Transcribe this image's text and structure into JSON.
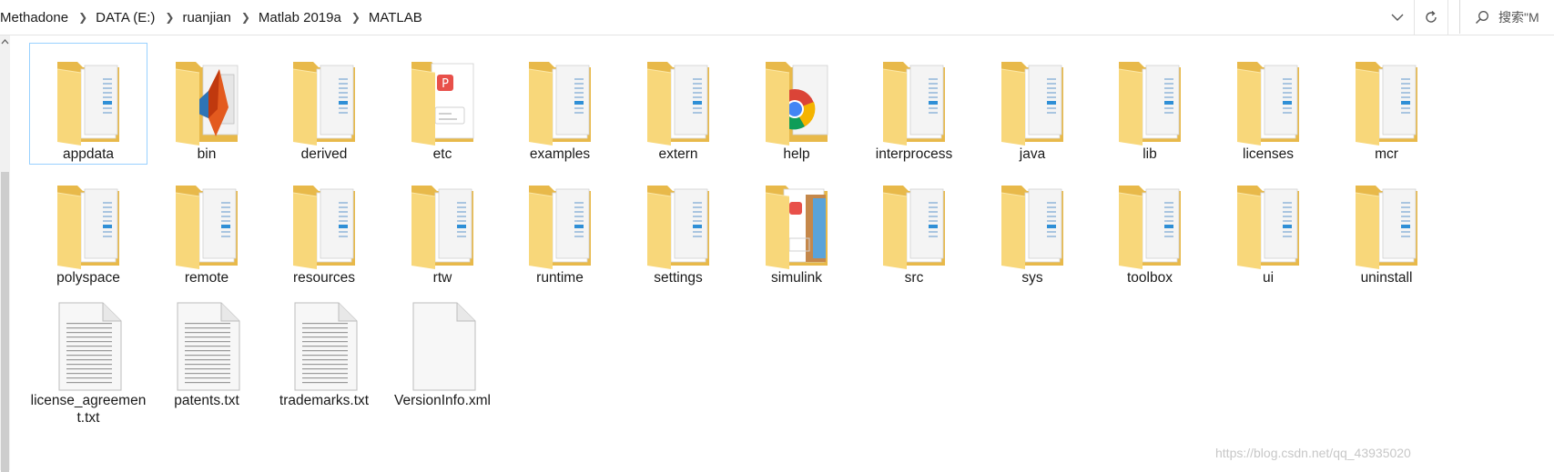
{
  "address_bar": {
    "breadcrumbs": [
      "Methadone",
      "DATA (E:)",
      "ruanjian",
      "Matlab 2019a",
      "MATLAB"
    ],
    "search_placeholder": "搜索\"M"
  },
  "items": [
    {
      "label": "appdata",
      "type": "folder",
      "icon": "folder-icon",
      "selected": true
    },
    {
      "label": "bin",
      "type": "folder",
      "icon": "matlab-folder-icon"
    },
    {
      "label": "derived",
      "type": "folder",
      "icon": "folder-icon"
    },
    {
      "label": "etc",
      "type": "folder",
      "icon": "pdf-folder-icon"
    },
    {
      "label": "examples",
      "type": "folder",
      "icon": "folder-icon"
    },
    {
      "label": "extern",
      "type": "folder",
      "icon": "folder-icon"
    },
    {
      "label": "help",
      "type": "folder",
      "icon": "chrome-folder-icon"
    },
    {
      "label": "interprocess",
      "type": "folder",
      "icon": "folder-icon"
    },
    {
      "label": "java",
      "type": "folder",
      "icon": "folder-icon"
    },
    {
      "label": "lib",
      "type": "folder",
      "icon": "folder-icon"
    },
    {
      "label": "licenses",
      "type": "folder",
      "icon": "folder-icon"
    },
    {
      "label": "mcr",
      "type": "folder",
      "icon": "folder-icon"
    },
    {
      "label": "polyspace",
      "type": "folder",
      "icon": "folder-icon"
    },
    {
      "label": "remote",
      "type": "folder",
      "icon": "folder-icon"
    },
    {
      "label": "resources",
      "type": "folder",
      "icon": "folder-icon"
    },
    {
      "label": "rtw",
      "type": "folder",
      "icon": "folder-icon"
    },
    {
      "label": "runtime",
      "type": "folder",
      "icon": "folder-icon"
    },
    {
      "label": "settings",
      "type": "folder",
      "icon": "folder-icon"
    },
    {
      "label": "simulink",
      "type": "folder",
      "icon": "image-folder-icon"
    },
    {
      "label": "src",
      "type": "folder",
      "icon": "folder-icon"
    },
    {
      "label": "sys",
      "type": "folder",
      "icon": "folder-icon"
    },
    {
      "label": "toolbox",
      "type": "folder",
      "icon": "folder-icon"
    },
    {
      "label": "ui",
      "type": "folder",
      "icon": "folder-icon"
    },
    {
      "label": "uninstall",
      "type": "folder",
      "icon": "folder-icon"
    },
    {
      "label": "license_agreement.txt",
      "type": "text",
      "icon": "text-file-icon"
    },
    {
      "label": "patents.txt",
      "type": "text",
      "icon": "text-file-icon"
    },
    {
      "label": "trademarks.txt",
      "type": "text",
      "icon": "text-file-icon"
    },
    {
      "label": "VersionInfo.xml",
      "type": "xml",
      "icon": "xml-file-icon"
    }
  ],
  "watermark": "https://blog.csdn.net/qq_43935020",
  "colors": {
    "folder_back": "#e8b94a",
    "folder_front": "#f8d77a",
    "selection_border": "#99d1ff"
  }
}
